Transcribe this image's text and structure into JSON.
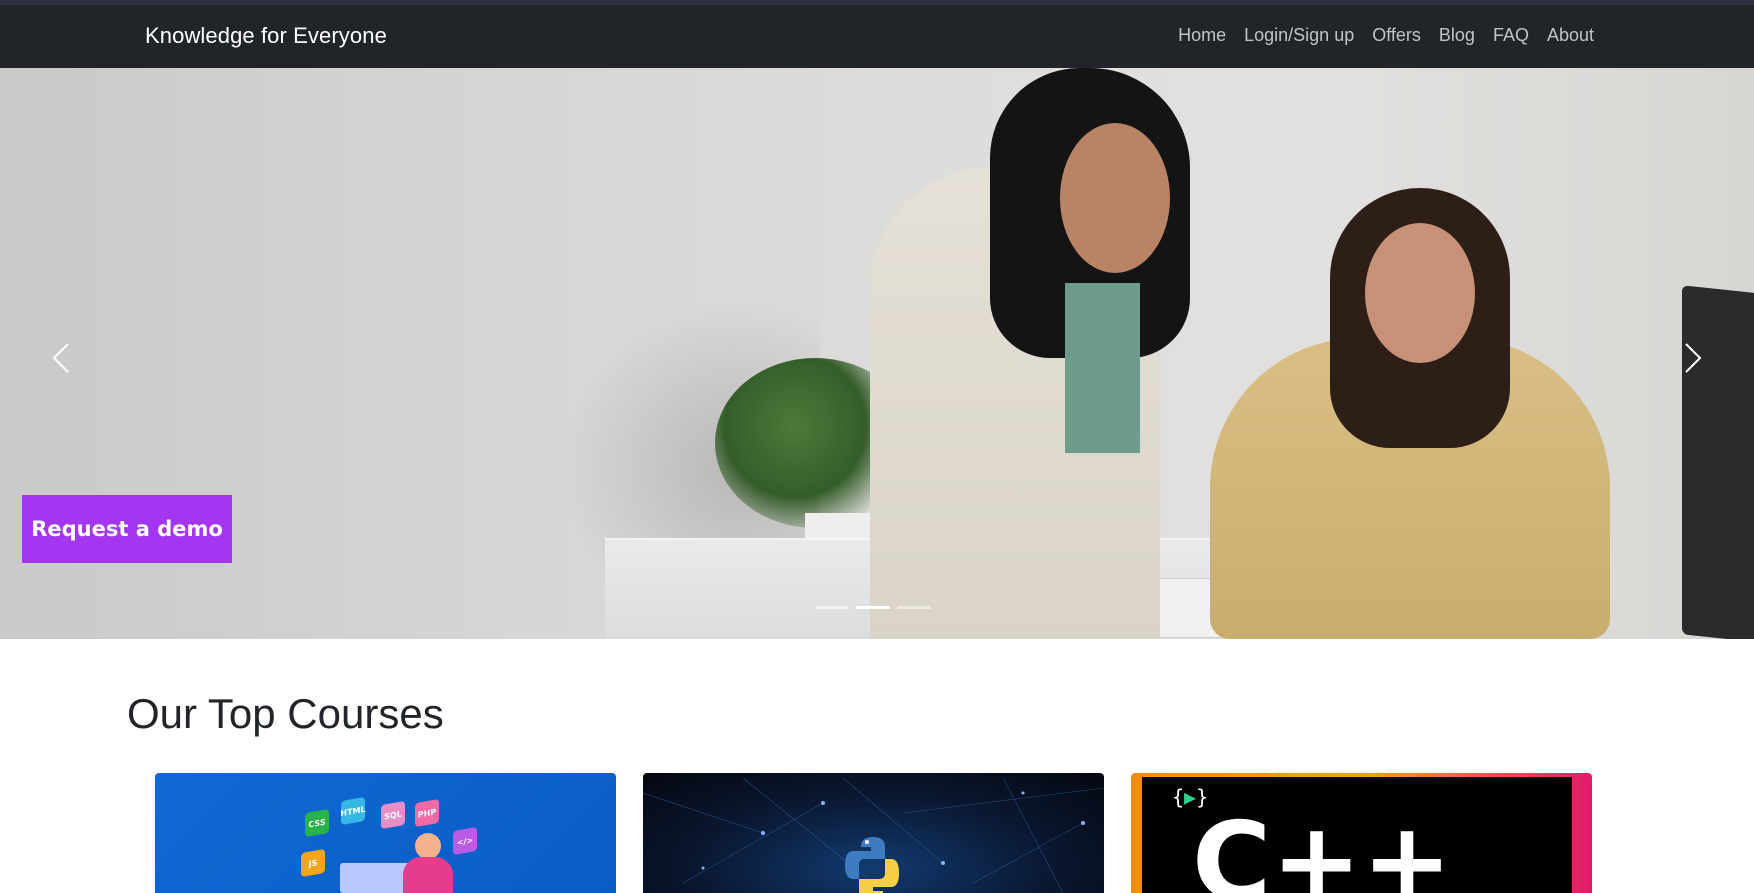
{
  "navbar": {
    "brand": "Knowledge for Everyone",
    "links": [
      "Home",
      "Login/Sign up",
      "Offers",
      "Blog",
      "FAQ",
      "About"
    ],
    "background": "#212529"
  },
  "hero": {
    "cta_label": "Request a demo",
    "cta_color": "#a435f0",
    "image_alt": "Two women smiling at a desk with a plant and computer monitor",
    "slide_count": 3,
    "active_slide": 2
  },
  "courses": {
    "heading": "Our Top Courses",
    "cards": [
      {
        "icon": "web-development-illustration",
        "chips": [
          "CSS",
          "HTML",
          "SQL",
          "PHP",
          "</>",
          "JS"
        ]
      },
      {
        "icon": "python-logo"
      },
      {
        "icon": "cpp-logo",
        "title_text": "C++"
      }
    ]
  },
  "icons": [
    "chevron-left-icon",
    "chevron-right-icon"
  ]
}
